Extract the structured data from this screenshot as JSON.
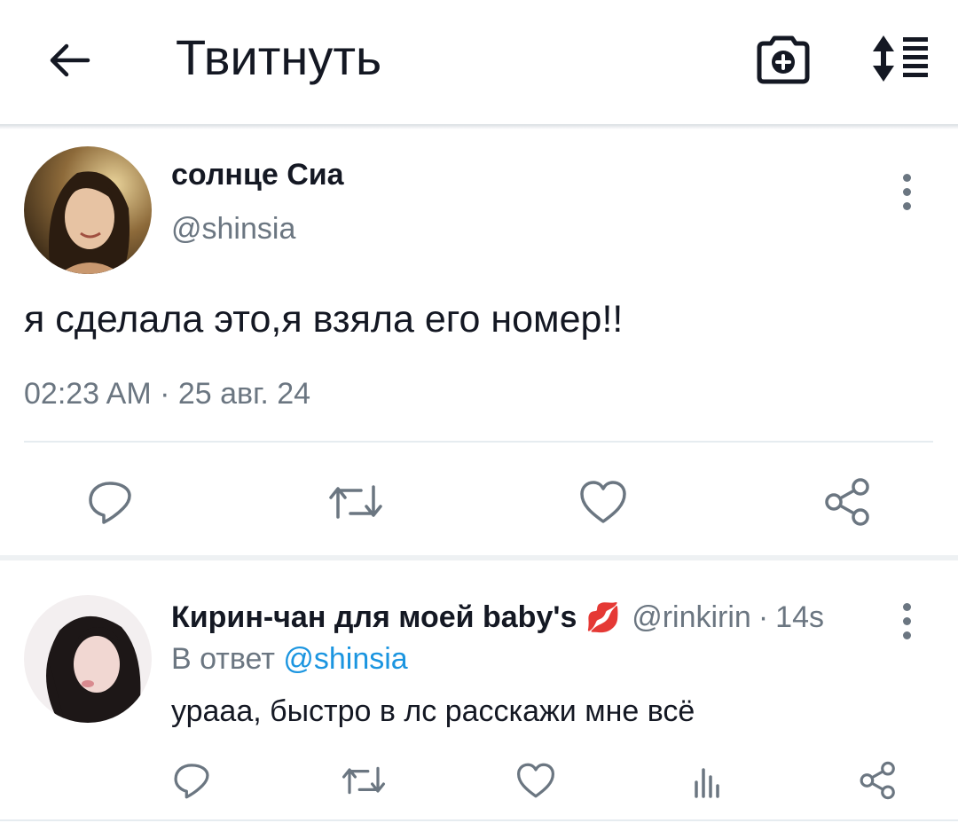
{
  "header": {
    "title": "Твитнуть",
    "back_icon": "arrow-left-icon",
    "camera_icon": "camera-add-icon",
    "sort_icon": "sort-list-icon"
  },
  "tweet": {
    "display_name": "солнце Сиа",
    "handle": "@shinsia",
    "text": "я сделала это,я взяла его номер!!",
    "timestamp": "02:23 AM · 25 авг. 24",
    "actions": [
      "reply-icon",
      "retweet-icon",
      "like-icon",
      "share-icon"
    ]
  },
  "reply": {
    "display_name": "Кирин-чан для моей baby's",
    "emoji": "💋",
    "handle": "@rinkirin",
    "time": "14s",
    "in_reply_prefix": "В ответ",
    "in_reply_handle": "@shinsia",
    "text": "урааа, быстро в лс расскажи мне всё",
    "actions": [
      "reply-icon",
      "retweet-icon",
      "like-icon",
      "stats-icon",
      "share-icon"
    ]
  },
  "colors": {
    "text": "#141823",
    "muted": "#6b7681",
    "link": "#1b95e0",
    "divider": "#e6ecf0",
    "lips": "#e0245e"
  }
}
